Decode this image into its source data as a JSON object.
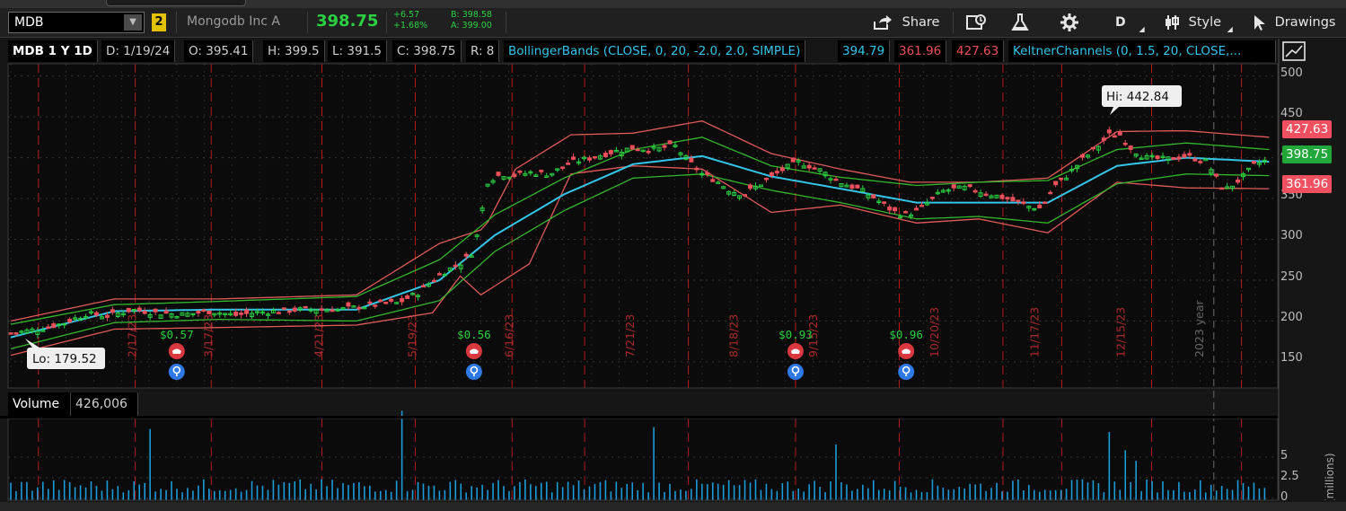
{
  "toolbar": {
    "symbol": "MDB",
    "link_group": "2",
    "company": "Mongodb Inc A",
    "last_price": "398.75",
    "net_change": "+6.57",
    "pct_change": "+1.68%",
    "bid": "B: 398.58",
    "ask": "A: 399.00",
    "share_label": "Share",
    "aggregation_label": "D",
    "style_label": "Style",
    "drawings_label": "Drawings",
    "icons": [
      "share-icon",
      "quick-chart-icon",
      "flask-icon",
      "gear-icon",
      "style-icon",
      "cursor-icon"
    ]
  },
  "legend": {
    "symbol_period": "MDB 1 Y 1D",
    "date": "D: 1/19/24",
    "open": "O: 395.41",
    "high": "H: 399.5",
    "low": "L: 391.5",
    "close": "C: 398.75",
    "range": "R: 8",
    "bb_name": "BollingerBands (CLOSE, 0, 20, -2.0, 2.0, SIMPLE)",
    "bb_mid": "394.79",
    "bb_lower": "361.96",
    "bb_upper": "427.63",
    "kc_name": "KeltnerChannels (0, 1.5, 20, CLOSE,..."
  },
  "annotations": {
    "hi": "Hi: 442.84",
    "lo": "Lo: 179.52",
    "year_marker": "2023 year",
    "dividends": [
      "$0.57",
      "$0.56",
      "$0.93",
      "$0.96"
    ]
  },
  "price_axis": {
    "labels": [
      "500",
      "450",
      "400",
      "350",
      "300",
      "250",
      "200",
      "150"
    ],
    "upper_box": "427.63",
    "last_box": "398.75",
    "lower_box": "361.96"
  },
  "volume": {
    "label": "Volume",
    "value": "426,006",
    "axis_labels": [
      "5",
      "2.5",
      "0"
    ],
    "unit": "(millions)"
  },
  "colors": {
    "up": "#2bd142",
    "down": "#e9505a",
    "bb_mid": "#34c6e9",
    "bb_band": "#e05a5a",
    "kc_band": "#35b62f",
    "volume": "#1c9bd8",
    "event_line": "#d21f1f",
    "dividend": "#2bd142"
  },
  "chart_data": {
    "type": "candlestick",
    "title": "MDB 1 Y 1D",
    "x_dates": [
      "2/17/23",
      "3/17/23",
      "4/21/23",
      "5/19/23",
      "6/16/23",
      "7/21/23",
      "8/18/23",
      "9/15/23",
      "10/20/23",
      "11/17/23",
      "12/15/23"
    ],
    "ylim": [
      118,
      515
    ],
    "close_path": [
      [
        0,
        185
      ],
      [
        8,
        190
      ],
      [
        15,
        197
      ],
      [
        22,
        209
      ],
      [
        28,
        206
      ],
      [
        35,
        214
      ],
      [
        42,
        210
      ],
      [
        50,
        208
      ],
      [
        58,
        212
      ],
      [
        65,
        207
      ],
      [
        72,
        211
      ],
      [
        80,
        213
      ],
      [
        88,
        215
      ],
      [
        95,
        214
      ],
      [
        102,
        218
      ],
      [
        108,
        222
      ],
      [
        112,
        222
      ],
      [
        118,
        235
      ],
      [
        122,
        250
      ],
      [
        126,
        262
      ],
      [
        130,
        270
      ],
      [
        134,
        286
      ],
      [
        138,
        372
      ],
      [
        142,
        380
      ],
      [
        146,
        378
      ],
      [
        150,
        382
      ],
      [
        156,
        380
      ],
      [
        162,
        394
      ],
      [
        168,
        400
      ],
      [
        174,
        407
      ],
      [
        180,
        412
      ],
      [
        186,
        410
      ],
      [
        192,
        415
      ],
      [
        196,
        396
      ],
      [
        200,
        380
      ],
      [
        204,
        372
      ],
      [
        208,
        360
      ],
      [
        212,
        355
      ],
      [
        218,
        371
      ],
      [
        224,
        387
      ],
      [
        228,
        395
      ],
      [
        234,
        385
      ],
      [
        240,
        370
      ],
      [
        246,
        360
      ],
      [
        250,
        350
      ],
      [
        255,
        335
      ],
      [
        258,
        330
      ],
      [
        262,
        334
      ],
      [
        266,
        348
      ],
      [
        270,
        360
      ],
      [
        276,
        363
      ],
      [
        282,
        357
      ],
      [
        288,
        350
      ],
      [
        294,
        341
      ],
      [
        298,
        338
      ],
      [
        302,
        365
      ],
      [
        306,
        380
      ],
      [
        310,
        398
      ],
      [
        314,
        412
      ],
      [
        318,
        429
      ],
      [
        321,
        428
      ],
      [
        324,
        412
      ],
      [
        328,
        400
      ],
      [
        334,
        398
      ],
      [
        340,
        402
      ],
      [
        346,
        395
      ],
      [
        350,
        365
      ],
      [
        352,
        362
      ],
      [
        356,
        375
      ],
      [
        360,
        392
      ],
      [
        364,
        398
      ]
    ],
    "hi": 442.84,
    "lo": 179.52,
    "bollinger_upper": [
      [
        0,
        200
      ],
      [
        30,
        227
      ],
      [
        60,
        227
      ],
      [
        100,
        232
      ],
      [
        124,
        295
      ],
      [
        137,
        313
      ],
      [
        146,
        386
      ],
      [
        162,
        428
      ],
      [
        180,
        430
      ],
      [
        200,
        445
      ],
      [
        220,
        405
      ],
      [
        240,
        386
      ],
      [
        260,
        370
      ],
      [
        280,
        370
      ],
      [
        300,
        375
      ],
      [
        320,
        432
      ],
      [
        340,
        433
      ],
      [
        364,
        425
      ]
    ],
    "bollinger_lower": [
      [
        0,
        158
      ],
      [
        30,
        190
      ],
      [
        60,
        192
      ],
      [
        100,
        195
      ],
      [
        122,
        210
      ],
      [
        130,
        255
      ],
      [
        136,
        232
      ],
      [
        150,
        270
      ],
      [
        162,
        380
      ],
      [
        180,
        390
      ],
      [
        200,
        386
      ],
      [
        220,
        333
      ],
      [
        240,
        342
      ],
      [
        262,
        320
      ],
      [
        280,
        325
      ],
      [
        300,
        308
      ],
      [
        320,
        370
      ],
      [
        340,
        363
      ],
      [
        364,
        362
      ]
    ],
    "bollinger_mid": [
      [
        0,
        180
      ],
      [
        30,
        212
      ],
      [
        60,
        214
      ],
      [
        100,
        214
      ],
      [
        124,
        250
      ],
      [
        140,
        305
      ],
      [
        160,
        355
      ],
      [
        180,
        392
      ],
      [
        200,
        402
      ],
      [
        220,
        377
      ],
      [
        240,
        362
      ],
      [
        262,
        345
      ],
      [
        280,
        345
      ],
      [
        300,
        345
      ],
      [
        320,
        390
      ],
      [
        340,
        400
      ],
      [
        364,
        395
      ]
    ],
    "keltner_upper": [
      [
        0,
        196
      ],
      [
        30,
        220
      ],
      [
        60,
        224
      ],
      [
        100,
        230
      ],
      [
        124,
        275
      ],
      [
        140,
        330
      ],
      [
        160,
        375
      ],
      [
        180,
        410
      ],
      [
        200,
        425
      ],
      [
        220,
        390
      ],
      [
        240,
        376
      ],
      [
        262,
        366
      ],
      [
        280,
        370
      ],
      [
        300,
        372
      ],
      [
        320,
        410
      ],
      [
        340,
        418
      ],
      [
        364,
        410
      ]
    ],
    "keltner_lower": [
      [
        0,
        166
      ],
      [
        30,
        198
      ],
      [
        60,
        202
      ],
      [
        100,
        200
      ],
      [
        124,
        225
      ],
      [
        140,
        285
      ],
      [
        160,
        335
      ],
      [
        180,
        375
      ],
      [
        200,
        380
      ],
      [
        220,
        360
      ],
      [
        240,
        345
      ],
      [
        262,
        325
      ],
      [
        280,
        328
      ],
      [
        300,
        320
      ],
      [
        320,
        368
      ],
      [
        340,
        380
      ],
      [
        364,
        378
      ]
    ],
    "volume_millions_peaks": [
      [
        40,
        7.4
      ],
      [
        113,
        9.3
      ],
      [
        186,
        7.6
      ],
      [
        239,
        5.8
      ],
      [
        253,
        1.2
      ],
      [
        318,
        7.1
      ],
      [
        322,
        5.2
      ],
      [
        326,
        4.1
      ]
    ],
    "volume_ylim": [
      0,
      8.5
    ],
    "dividend_days": [
      41,
      113,
      188,
      273,
      269
    ],
    "month_event_days": [
      8,
      36,
      58,
      90,
      117,
      145,
      166,
      196,
      227,
      257,
      287,
      304,
      330,
      356
    ]
  }
}
